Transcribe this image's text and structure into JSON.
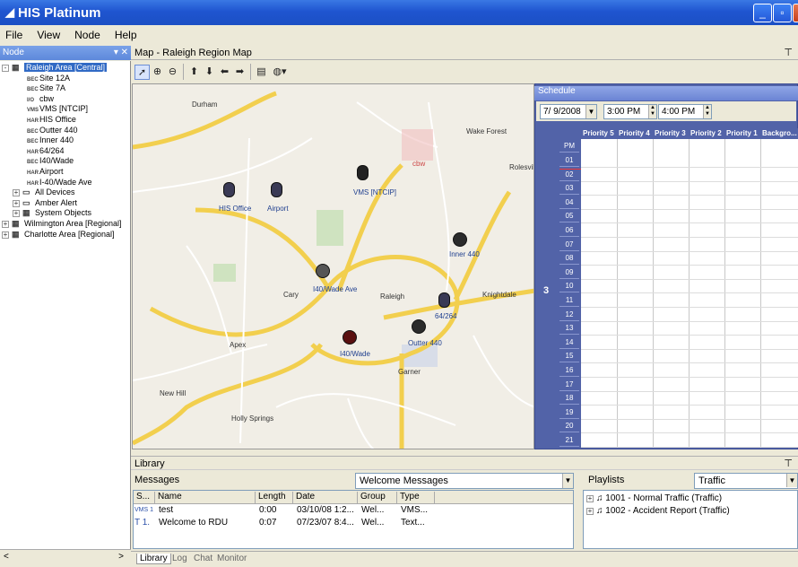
{
  "window": {
    "title": "HIS Platinum",
    "icon": "app-logo-icon"
  },
  "menu": [
    "File",
    "View",
    "Node",
    "Help"
  ],
  "node_panel": {
    "title": "Node",
    "tree": [
      {
        "label": "Raleigh Area [Central]",
        "icon": "server-icon",
        "selected": true,
        "expander": "-"
      },
      {
        "label": "Site 12A",
        "icon": "BEC"
      },
      {
        "label": "Site 7A",
        "icon": "BEC"
      },
      {
        "label": "cbw",
        "icon": "I/O"
      },
      {
        "label": "VMS [NTCIP]",
        "icon": "VMS"
      },
      {
        "label": "HIS Office",
        "icon": "HAR"
      },
      {
        "label": "Outter 440",
        "icon": "BEC"
      },
      {
        "label": "Inner 440",
        "icon": "BEC"
      },
      {
        "label": "64/264",
        "icon": "HAR"
      },
      {
        "label": "I40/Wade",
        "icon": "BEC"
      },
      {
        "label": "Airport",
        "icon": "HAR"
      },
      {
        "label": "I-40/Wade Ave",
        "icon": "HAR"
      },
      {
        "label": "All Devices",
        "icon": "folder-icon",
        "expander": "+"
      },
      {
        "label": "Amber Alert",
        "icon": "folder-icon",
        "expander": "+"
      },
      {
        "label": "System Objects",
        "icon": "objects-icon",
        "expander": "+"
      },
      {
        "label": "Wilmington Area [Regional]",
        "icon": "server-icon",
        "expander": "+"
      },
      {
        "label": "Charlotte Area [Regional]",
        "icon": "server-icon",
        "expander": "+"
      }
    ]
  },
  "map_panel": {
    "title": "Map - Raleigh Region Map",
    "labels": [
      "HIS Office",
      "Airport",
      "VMS [NTCIP]",
      "cbw",
      "Inner 440",
      "I40/Wade Ave",
      "64/264",
      "Outter 440",
      "I40/Wade"
    ],
    "towns": [
      "Durham",
      "Raleigh",
      "Cary",
      "Garner",
      "Knightdale",
      "Apex",
      "New Hill",
      "Holly Springs",
      "Wake Forest",
      "Rolesville"
    ]
  },
  "schedule": {
    "title": "Schedule",
    "date": "7/ 9/2008",
    "start_time": "3:00 PM",
    "end_time": "4:00 PM",
    "columns": [
      "Priority 5",
      "Priority 4",
      "Priority 3",
      "Priority 2",
      "Priority 1",
      "Backgro..."
    ],
    "period": "PM",
    "hours": [
      "01",
      "02",
      "03",
      "04",
      "05",
      "06",
      "07",
      "08",
      "09",
      "10",
      "11",
      "12",
      "13",
      "14",
      "15",
      "16",
      "17",
      "18",
      "19",
      "20",
      "21"
    ],
    "day": "3"
  },
  "library": {
    "title": "Library",
    "messages_label": "Messages",
    "messages_filter": "Welcome Messages",
    "columns": [
      "S...",
      "Name",
      "Length",
      "Date",
      "Group",
      "Type"
    ],
    "rows": [
      {
        "s": "VMS 1",
        "name": "test",
        "length": "0:00",
        "date": "03/10/08 1:2...",
        "group": "Wel...",
        "type": "VMS..."
      },
      {
        "s": "T 1.",
        "name": "Welcome to RDU",
        "length": "0:07",
        "date": "07/23/07 8:4...",
        "group": "Wel...",
        "type": "Text..."
      }
    ],
    "playlists_label": "Playlists",
    "playlists_filter": "Traffic",
    "playlists": [
      "1001 - Normal Traffic (Traffic)",
      "1002 - Accident Report (Traffic)"
    ]
  },
  "tabs": [
    "Library",
    "Log",
    "Chat",
    "Monitor"
  ]
}
